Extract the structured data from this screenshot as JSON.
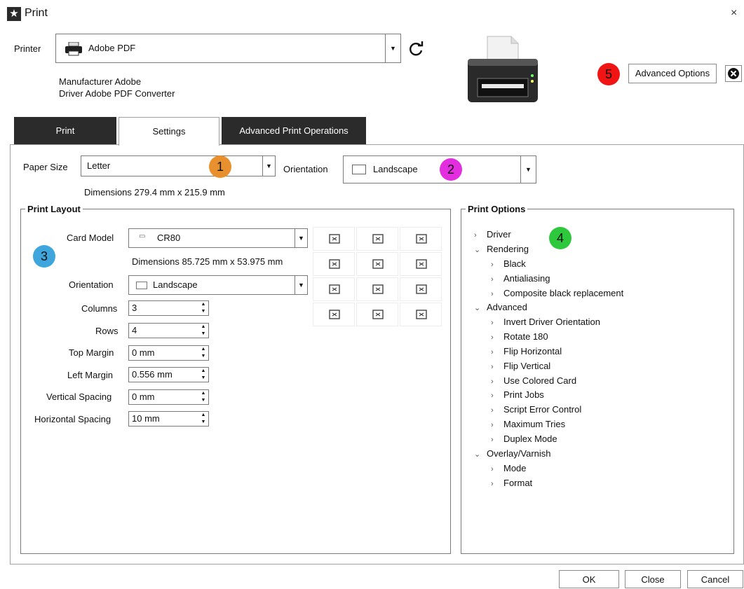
{
  "window": {
    "title": "Print",
    "close_label": "×"
  },
  "printer": {
    "label": "Printer",
    "selected": "Adobe PDF",
    "manufacturer": "Manufacturer Adobe",
    "driver": "Driver Adobe PDF Converter"
  },
  "badges": [
    "1",
    "2",
    "3",
    "4",
    "5"
  ],
  "advanced_options_label": "Advanced Options",
  "tabs": [
    {
      "label": "Print"
    },
    {
      "label": "Settings"
    },
    {
      "label": "Advanced Print Operations"
    }
  ],
  "settings": {
    "paper_size_label": "Paper Size",
    "paper_size_value": "Letter",
    "orientation_label": "Orientation",
    "orientation_value": "Landscape",
    "dimensions_text": "Dimensions 279.4 mm x 215.9 mm"
  },
  "print_layout": {
    "title": "Print Layout",
    "card_model_label": "Card Model",
    "card_model_value": "CR80",
    "card_dimensions": "Dimensions 85.725 mm x 53.975 mm",
    "orientation_label": "Orientation",
    "orientation_value": "Landscape",
    "fields": [
      {
        "label": "Columns",
        "value": "3"
      },
      {
        "label": "Rows",
        "value": "4"
      },
      {
        "label": "Top Margin",
        "value": "0 mm"
      },
      {
        "label": "Left Margin",
        "value": "0.556 mm"
      },
      {
        "label": "Vertical Spacing",
        "value": "0 mm"
      },
      {
        "label": "Horizontal Spacing",
        "value": "10 mm"
      }
    ]
  },
  "print_options": {
    "title": "Print Options",
    "tree": [
      {
        "label": "Driver",
        "chev": ">"
      },
      {
        "label": "Rendering",
        "chev": "v"
      },
      {
        "label": "Black",
        "chev": ">"
      },
      {
        "label": "Antialiasing",
        "chev": ">"
      },
      {
        "label": "Composite black replacement",
        "chev": ">"
      },
      {
        "label": "Advanced",
        "chev": "v"
      },
      {
        "label": "Invert Driver Orientation",
        "chev": ">"
      },
      {
        "label": "Rotate 180",
        "chev": ">"
      },
      {
        "label": "Flip Horizontal",
        "chev": ">"
      },
      {
        "label": "Flip Vertical",
        "chev": ">"
      },
      {
        "label": "Use Colored Card",
        "chev": ">"
      },
      {
        "label": "Print Jobs",
        "chev": ">"
      },
      {
        "label": "Script Error Control",
        "chev": ">"
      },
      {
        "label": "Maximum Tries",
        "chev": ">"
      },
      {
        "label": "Duplex Mode",
        "chev": ">"
      },
      {
        "label": "Overlay/Varnish",
        "chev": "v"
      },
      {
        "label": "Mode",
        "chev": ">"
      },
      {
        "label": "Format",
        "chev": ">"
      }
    ]
  },
  "footer": {
    "ok": "OK",
    "close": "Close",
    "cancel": "Cancel"
  },
  "colors": {
    "badge_1": "#e8902e",
    "badge_2": "#e32ee0",
    "badge_3": "#3ea6dc",
    "badge_4": "#2ec83c",
    "badge_5": "#f01414",
    "tab_dark": "#2b2b2b"
  }
}
